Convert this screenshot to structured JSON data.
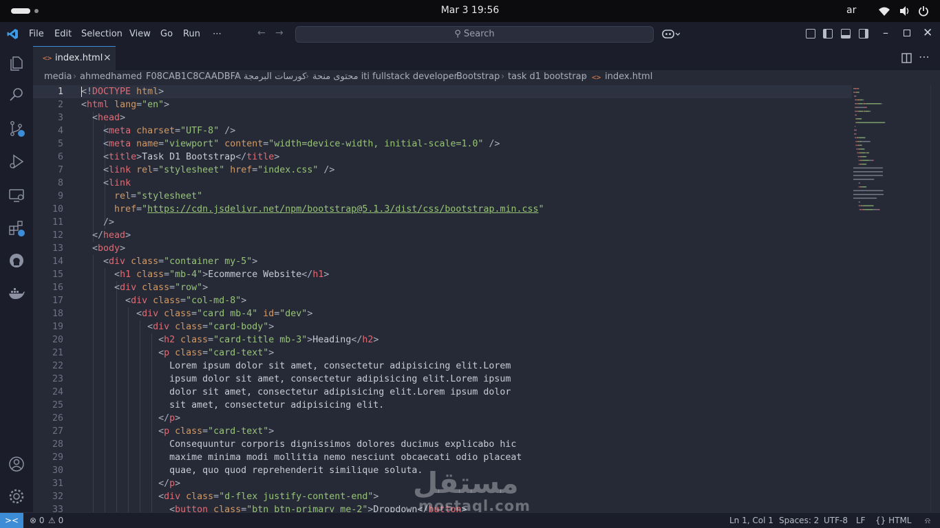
{
  "topbar": {
    "clock": "Mar 3  19:56",
    "language": "ar"
  },
  "titlebar": {
    "menus": [
      "File",
      "Edit",
      "Selection",
      "View",
      "Go",
      "Run",
      "⋯"
    ],
    "search_label": "Search"
  },
  "activity_bar": {
    "icons": [
      "explorer-icon",
      "search-icon",
      "source-control-icon",
      "run-debug-icon",
      "remote-explorer-icon",
      "extensions-icon",
      "github-icon",
      "docker-icon",
      "account-icon",
      "settings-gear-icon"
    ]
  },
  "tabs": [
    {
      "label": "index.html",
      "icon": "html-file-icon",
      "close": "×"
    }
  ],
  "breadcrumb": {
    "segments": [
      "media",
      "ahmedhamed",
      "F08CAB1C8CAADBFA",
      "كورسات البرمجة",
      "محتوى منحة iti fullstack developer",
      "Bootstrap",
      "task d1 bootstrap",
      "index.html"
    ],
    "separator": "›"
  },
  "editor": {
    "lines": [
      {
        "n": "1",
        "tokens": [
          [
            "p",
            "<!"
          ],
          [
            "t",
            "DOCTYPE"
          ],
          [
            "x",
            " "
          ],
          [
            "a",
            "html"
          ],
          [
            "p",
            ">"
          ]
        ]
      },
      {
        "n": "2",
        "tokens": [
          [
            "p",
            "<"
          ],
          [
            "t",
            "html"
          ],
          [
            "x",
            " "
          ],
          [
            "a",
            "lang"
          ],
          [
            "p",
            "="
          ],
          [
            "s",
            "\"en\""
          ],
          [
            "p",
            ">"
          ]
        ]
      },
      {
        "n": "3",
        "tokens": [
          [
            "x",
            "  "
          ],
          [
            "p",
            "<"
          ],
          [
            "t",
            "head"
          ],
          [
            "p",
            ">"
          ]
        ]
      },
      {
        "n": "4",
        "tokens": [
          [
            "x",
            "    "
          ],
          [
            "p",
            "<"
          ],
          [
            "t",
            "meta"
          ],
          [
            "x",
            " "
          ],
          [
            "a",
            "charset"
          ],
          [
            "p",
            "="
          ],
          [
            "s",
            "\"UTF-8\""
          ],
          [
            "x",
            " "
          ],
          [
            "p",
            "/>"
          ]
        ]
      },
      {
        "n": "5",
        "tokens": [
          [
            "x",
            "    "
          ],
          [
            "p",
            "<"
          ],
          [
            "t",
            "meta"
          ],
          [
            "x",
            " "
          ],
          [
            "a",
            "name"
          ],
          [
            "p",
            "="
          ],
          [
            "s",
            "\"viewport\""
          ],
          [
            "x",
            " "
          ],
          [
            "a",
            "content"
          ],
          [
            "p",
            "="
          ],
          [
            "s",
            "\"width=device-width, initial-scale=1.0\""
          ],
          [
            "x",
            " "
          ],
          [
            "p",
            "/>"
          ]
        ]
      },
      {
        "n": "6",
        "tokens": [
          [
            "x",
            "    "
          ],
          [
            "p",
            "<"
          ],
          [
            "t",
            "title"
          ],
          [
            "p",
            ">"
          ],
          [
            "x",
            "Task D1 Bootstrap"
          ],
          [
            "p",
            "</"
          ],
          [
            "t",
            "title"
          ],
          [
            "p",
            ">"
          ]
        ]
      },
      {
        "n": "7",
        "tokens": [
          [
            "x",
            "    "
          ],
          [
            "p",
            "<"
          ],
          [
            "t",
            "link"
          ],
          [
            "x",
            " "
          ],
          [
            "a",
            "rel"
          ],
          [
            "p",
            "="
          ],
          [
            "s",
            "\"stylesheet\""
          ],
          [
            "x",
            " "
          ],
          [
            "a",
            "href"
          ],
          [
            "p",
            "="
          ],
          [
            "s",
            "\"index.css\""
          ],
          [
            "x",
            " "
          ],
          [
            "p",
            "/>"
          ]
        ]
      },
      {
        "n": "8",
        "tokens": [
          [
            "x",
            "    "
          ],
          [
            "p",
            "<"
          ],
          [
            "t",
            "link"
          ]
        ]
      },
      {
        "n": "9",
        "tokens": [
          [
            "x",
            "      "
          ],
          [
            "a",
            "rel"
          ],
          [
            "p",
            "="
          ],
          [
            "s",
            "\"stylesheet\""
          ]
        ]
      },
      {
        "n": "10",
        "tokens": [
          [
            "x",
            "      "
          ],
          [
            "a",
            "href"
          ],
          [
            "p",
            "="
          ],
          [
            "s",
            "\""
          ],
          [
            "u",
            "https://cdn.jsdelivr.net/npm/bootstrap@5.1.3/dist/css/bootstrap.min.css"
          ],
          [
            "s",
            "\""
          ]
        ]
      },
      {
        "n": "11",
        "tokens": [
          [
            "x",
            "    "
          ],
          [
            "p",
            "/>"
          ]
        ]
      },
      {
        "n": "12",
        "tokens": [
          [
            "x",
            "  "
          ],
          [
            "p",
            "</"
          ],
          [
            "t",
            "head"
          ],
          [
            "p",
            ">"
          ]
        ]
      },
      {
        "n": "13",
        "tokens": [
          [
            "x",
            "  "
          ],
          [
            "p",
            "<"
          ],
          [
            "t",
            "body"
          ],
          [
            "p",
            ">"
          ]
        ]
      },
      {
        "n": "14",
        "tokens": [
          [
            "x",
            "    "
          ],
          [
            "p",
            "<"
          ],
          [
            "t",
            "div"
          ],
          [
            "x",
            " "
          ],
          [
            "a",
            "class"
          ],
          [
            "p",
            "="
          ],
          [
            "s",
            "\"container my-5\""
          ],
          [
            "p",
            ">"
          ]
        ]
      },
      {
        "n": "15",
        "tokens": [
          [
            "x",
            "      "
          ],
          [
            "p",
            "<"
          ],
          [
            "t",
            "h1"
          ],
          [
            "x",
            " "
          ],
          [
            "a",
            "class"
          ],
          [
            "p",
            "="
          ],
          [
            "s",
            "\"mb-4\""
          ],
          [
            "p",
            ">"
          ],
          [
            "x",
            "Ecommerce Website"
          ],
          [
            "p",
            "</"
          ],
          [
            "t",
            "h1"
          ],
          [
            "p",
            ">"
          ]
        ]
      },
      {
        "n": "16",
        "tokens": [
          [
            "x",
            "      "
          ],
          [
            "p",
            "<"
          ],
          [
            "t",
            "div"
          ],
          [
            "x",
            " "
          ],
          [
            "a",
            "class"
          ],
          [
            "p",
            "="
          ],
          [
            "s",
            "\"row\""
          ],
          [
            "p",
            ">"
          ]
        ]
      },
      {
        "n": "17",
        "tokens": [
          [
            "x",
            "        "
          ],
          [
            "p",
            "<"
          ],
          [
            "t",
            "div"
          ],
          [
            "x",
            " "
          ],
          [
            "a",
            "class"
          ],
          [
            "p",
            "="
          ],
          [
            "s",
            "\"col-md-8\""
          ],
          [
            "p",
            ">"
          ]
        ]
      },
      {
        "n": "18",
        "tokens": [
          [
            "x",
            "          "
          ],
          [
            "p",
            "<"
          ],
          [
            "t",
            "div"
          ],
          [
            "x",
            " "
          ],
          [
            "a",
            "class"
          ],
          [
            "p",
            "="
          ],
          [
            "s",
            "\"card mb-4\""
          ],
          [
            "x",
            " "
          ],
          [
            "a",
            "id"
          ],
          [
            "p",
            "="
          ],
          [
            "s",
            "\"dev\""
          ],
          [
            "p",
            ">"
          ]
        ]
      },
      {
        "n": "19",
        "tokens": [
          [
            "x",
            "            "
          ],
          [
            "p",
            "<"
          ],
          [
            "t",
            "div"
          ],
          [
            "x",
            " "
          ],
          [
            "a",
            "class"
          ],
          [
            "p",
            "="
          ],
          [
            "s",
            "\"card-body\""
          ],
          [
            "p",
            ">"
          ]
        ]
      },
      {
        "n": "20",
        "tokens": [
          [
            "x",
            "              "
          ],
          [
            "p",
            "<"
          ],
          [
            "t",
            "h2"
          ],
          [
            "x",
            " "
          ],
          [
            "a",
            "class"
          ],
          [
            "p",
            "="
          ],
          [
            "s",
            "\"card-title mb-3\""
          ],
          [
            "p",
            ">"
          ],
          [
            "x",
            "Heading"
          ],
          [
            "p",
            "</"
          ],
          [
            "t",
            "h2"
          ],
          [
            "p",
            ">"
          ]
        ]
      },
      {
        "n": "21",
        "tokens": [
          [
            "x",
            "              "
          ],
          [
            "p",
            "<"
          ],
          [
            "t",
            "p"
          ],
          [
            "x",
            " "
          ],
          [
            "a",
            "class"
          ],
          [
            "p",
            "="
          ],
          [
            "s",
            "\"card-text\""
          ],
          [
            "p",
            ">"
          ]
        ]
      },
      {
        "n": "22",
        "tokens": [
          [
            "x",
            "                Lorem ipsum dolor sit amet, consectetur adipisicing elit.Lorem"
          ]
        ]
      },
      {
        "n": "23",
        "tokens": [
          [
            "x",
            "                ipsum dolor sit amet, consectetur adipisicing elit.Lorem ipsum"
          ]
        ]
      },
      {
        "n": "24",
        "tokens": [
          [
            "x",
            "                dolor sit amet, consectetur adipisicing elit.Lorem ipsum dolor"
          ]
        ]
      },
      {
        "n": "25",
        "tokens": [
          [
            "x",
            "                sit amet, consectetur adipisicing elit."
          ]
        ]
      },
      {
        "n": "26",
        "tokens": [
          [
            "x",
            "              "
          ],
          [
            "p",
            "</"
          ],
          [
            "t",
            "p"
          ],
          [
            "p",
            ">"
          ]
        ]
      },
      {
        "n": "27",
        "tokens": [
          [
            "x",
            "              "
          ],
          [
            "p",
            "<"
          ],
          [
            "t",
            "p"
          ],
          [
            "x",
            " "
          ],
          [
            "a",
            "class"
          ],
          [
            "p",
            "="
          ],
          [
            "s",
            "\"card-text\""
          ],
          [
            "p",
            ">"
          ]
        ]
      },
      {
        "n": "28",
        "tokens": [
          [
            "x",
            "                Consequuntur corporis dignissimos dolores ducimus explicabo hic"
          ]
        ]
      },
      {
        "n": "29",
        "tokens": [
          [
            "x",
            "                maxime minima modi mollitia nemo nesciunt obcaecati odio placeat"
          ]
        ]
      },
      {
        "n": "30",
        "tokens": [
          [
            "x",
            "                quae, quo quod reprehenderit similique soluta."
          ]
        ]
      },
      {
        "n": "31",
        "tokens": [
          [
            "x",
            "              "
          ],
          [
            "p",
            "</"
          ],
          [
            "t",
            "p"
          ],
          [
            "p",
            ">"
          ]
        ]
      },
      {
        "n": "32",
        "tokens": [
          [
            "x",
            "              "
          ],
          [
            "p",
            "<"
          ],
          [
            "t",
            "div"
          ],
          [
            "x",
            " "
          ],
          [
            "a",
            "class"
          ],
          [
            "p",
            "="
          ],
          [
            "s",
            "\"d-flex justify-content-end\""
          ],
          [
            "p",
            ">"
          ]
        ]
      },
      {
        "n": "33",
        "tokens": [
          [
            "x",
            "                "
          ],
          [
            "p",
            "<"
          ],
          [
            "t",
            "button"
          ],
          [
            "x",
            " "
          ],
          [
            "a",
            "class"
          ],
          [
            "p",
            "="
          ],
          [
            "s",
            "\"btn btn-primary me-2\""
          ],
          [
            "p",
            ">"
          ],
          [
            "x",
            "Dropdown"
          ],
          [
            "p",
            "</"
          ],
          [
            "t",
            "button"
          ],
          [
            "p",
            ">"
          ]
        ]
      }
    ]
  },
  "watermark": {
    "arabic": "مستقل",
    "latin": "mostaql.com"
  },
  "statusbar": {
    "remote": "><",
    "errors": "⊗ 0",
    "warnings": "⚠ 0",
    "cursor": "Ln 1, Col 1",
    "spaces": "Spaces: 2",
    "encoding": "UTF-8",
    "eol": "LF",
    "language": "{} HTML",
    "bell": "⍾"
  },
  "colors": {
    "accent": "#3c8dd6",
    "tag": "#e06c75",
    "attribute": "#d19a66",
    "string": "#98c379",
    "editor_bg": "#262a37",
    "chrome_bg": "#1b1e2a"
  }
}
